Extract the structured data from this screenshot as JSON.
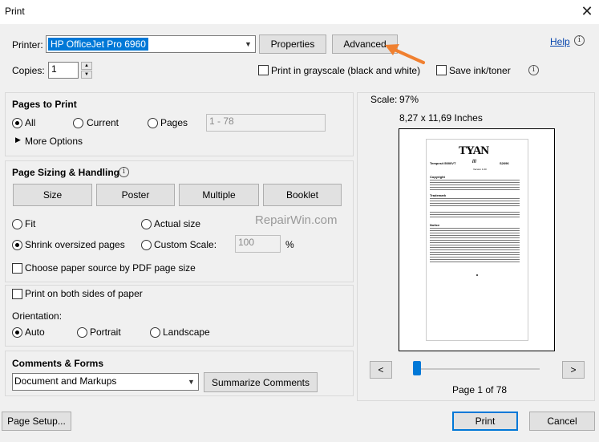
{
  "window": {
    "title": "Print",
    "close_glyph": "✕"
  },
  "printer": {
    "label": "Printer:",
    "selected": "HP OfficeJet Pro 6960",
    "properties_label": "Properties",
    "advanced_label": "Advanced",
    "help_label": "Help",
    "help_icon": "info-icon"
  },
  "copies": {
    "label": "Copies:",
    "value": "1",
    "grayscale_label": "Print in grayscale (black and white)",
    "save_ink_label": "Save ink/toner"
  },
  "pages_to_print": {
    "heading": "Pages to Print",
    "all_label": "All",
    "current_label": "Current",
    "pages_label": "Pages",
    "range_value": "1 - 78",
    "more_options_label": "More Options",
    "selected": "All"
  },
  "sizing": {
    "heading": "Page Sizing & Handling",
    "size_label": "Size",
    "poster_label": "Poster",
    "multiple_label": "Multiple",
    "booklet_label": "Booklet",
    "fit_label": "Fit",
    "actual_size_label": "Actual size",
    "shrink_label": "Shrink oversized pages",
    "custom_scale_label": "Custom Scale:",
    "custom_scale_value": "100",
    "percent_sign": "%",
    "paper_source_label": "Choose paper source by PDF page size",
    "selected": "Shrink oversized pages"
  },
  "duplex": {
    "both_sides_label": "Print on both sides of paper",
    "orientation_label": "Orientation:",
    "auto_label": "Auto",
    "portrait_label": "Portrait",
    "landscape_label": "Landscape",
    "selected": "Auto"
  },
  "comments": {
    "heading": "Comments & Forms",
    "selected": "Document and Markups",
    "summarize_label": "Summarize Comments"
  },
  "preview": {
    "scale_label": "Scale:",
    "scale_value": "97%",
    "page_dimensions": "8,27 x 11,69 Inches",
    "prev_glyph": "<",
    "next_glyph": ">",
    "page_indicator": "Page 1 of 78",
    "slider_fraction": 0.0,
    "doc_logo": "TYAN",
    "doc_heading_left": "Tempest i5000VT",
    "doc_heading_mid": "///",
    "doc_heading_right": "S2696",
    "doc_sub": "Version 1.00",
    "doc_section1": "Copyright",
    "doc_section2": "Trademark",
    "doc_section3": "Notice"
  },
  "watermark": "RepairWin.com",
  "footer": {
    "page_setup_label": "Page Setup...",
    "print_label": "Print",
    "cancel_label": "Cancel"
  },
  "colors": {
    "accent": "#0078d7",
    "arrow": "#f08030",
    "link": "#0645ad"
  }
}
